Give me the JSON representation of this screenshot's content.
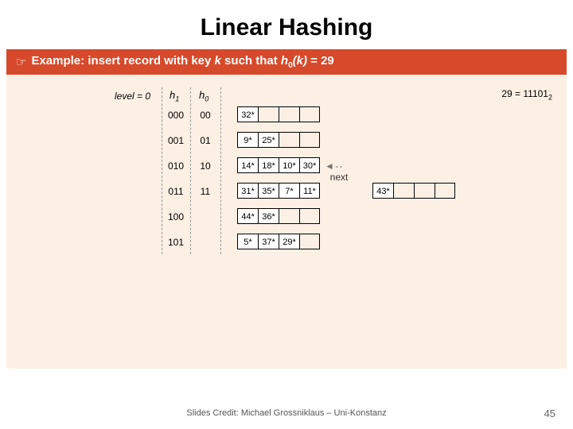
{
  "title": "Linear Hashing",
  "subtitle_prefix": "Example: insert record with key ",
  "subtitle_k": "k",
  "subtitle_mid": " such that ",
  "subtitle_h": "h",
  "subtitle_h_sub": "0",
  "subtitle_arg": "(k)",
  "subtitle_val": " = 29",
  "level_label": "level = 0",
  "h1_label": "h",
  "h1_sub": "1",
  "h0_label": "h",
  "h0_sub": "0",
  "binary_note_lhs": "29 = 11101",
  "binary_note_sub": "2",
  "next_label": "next",
  "rows": [
    {
      "h1": "000",
      "h0": "00",
      "cells": [
        "32*",
        "",
        "",
        ""
      ],
      "overflow": null,
      "next": false
    },
    {
      "h1": "001",
      "h0": "01",
      "cells": [
        "9*",
        "25*",
        "",
        ""
      ],
      "overflow": null,
      "next": false
    },
    {
      "h1": "010",
      "h0": "10",
      "cells": [
        "14*",
        "18*",
        "10*",
        "30*"
      ],
      "overflow": null,
      "next": true
    },
    {
      "h1": "011",
      "h0": "11",
      "cells": [
        "31*",
        "35*",
        "7*",
        "11*"
      ],
      "overflow": [
        "43*",
        "",
        "",
        ""
      ],
      "next": false
    },
    {
      "h1": "100",
      "h0": "",
      "cells": [
        "44*",
        "36*",
        "",
        ""
      ],
      "overflow": null,
      "next": false
    },
    {
      "h1": "101",
      "h0": "",
      "cells": [
        "5*",
        "37*",
        "29*",
        ""
      ],
      "overflow": null,
      "next": false
    }
  ],
  "credit": "Slides Credit: Michael Grossniklaus – Uni-Konstanz",
  "page": "45"
}
